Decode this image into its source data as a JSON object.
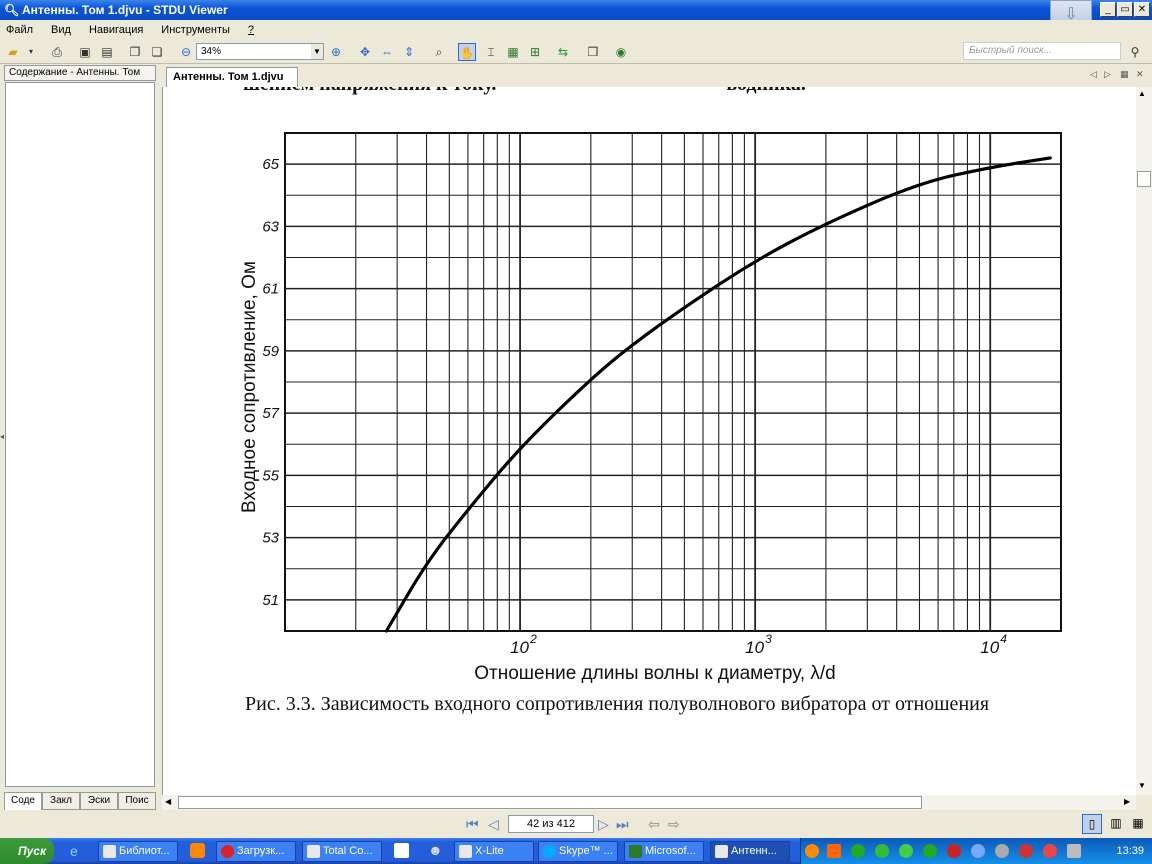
{
  "window": {
    "title": "Антенны. Том 1.djvu - STDU Viewer",
    "min": "_",
    "max": "▭",
    "close": "✕"
  },
  "menu": [
    "Файл",
    "Вид",
    "Навигация",
    "Инструменты",
    "?"
  ],
  "toolbar": {
    "zoom": "34%",
    "search_placeholder": "Быстрый поиск..."
  },
  "left_panel": {
    "header": "Содержание - Антенны. Том",
    "tabs": [
      "Соде",
      "Закл",
      "Эски",
      "Поис"
    ]
  },
  "doc_tab": "Антенны. Том 1.djvu",
  "page": {
    "top_text_fragment": "шением напряжения к току.",
    "top_text_right": "водника.",
    "caption": "Рис. 3.3. Зависимость входного сопротивления полуволнового вибратора от отношения"
  },
  "chart_data": {
    "type": "line",
    "title": "",
    "xlabel": "Отношение длины волны к диаметру, λ/d",
    "ylabel": "Входное сопротивление, Ом",
    "xscale": "log",
    "xlim": [
      10,
      20000
    ],
    "ylim": [
      50,
      66
    ],
    "xticks": [
      {
        "v": 100,
        "label": "10"
      },
      {
        "v": 1000,
        "label": "10"
      },
      {
        "v": 10000,
        "label": "10"
      }
    ],
    "xtick_exponents": [
      "2",
      "3",
      "4"
    ],
    "yticks": [
      51,
      53,
      55,
      57,
      59,
      61,
      63,
      65
    ],
    "grid": true,
    "series": [
      {
        "x": [
          27,
          40,
          60,
          100,
          200,
          300,
          500,
          1000,
          2000,
          5000,
          10000,
          18000
        ],
        "y": [
          50,
          52.2,
          53.9,
          55.9,
          58.1,
          59.2,
          60.4,
          61.9,
          63.1,
          64.4,
          64.9,
          65.2
        ]
      }
    ]
  },
  "status": {
    "page_label": "42 из 412"
  },
  "taskbar": {
    "start": "Пуск",
    "items": [
      "Библиот...",
      "Загрузк...",
      "Total Co...",
      "X-Lite",
      "Skype™ ...",
      "Microsof...",
      "Антенн..."
    ],
    "clock": "13:39"
  }
}
